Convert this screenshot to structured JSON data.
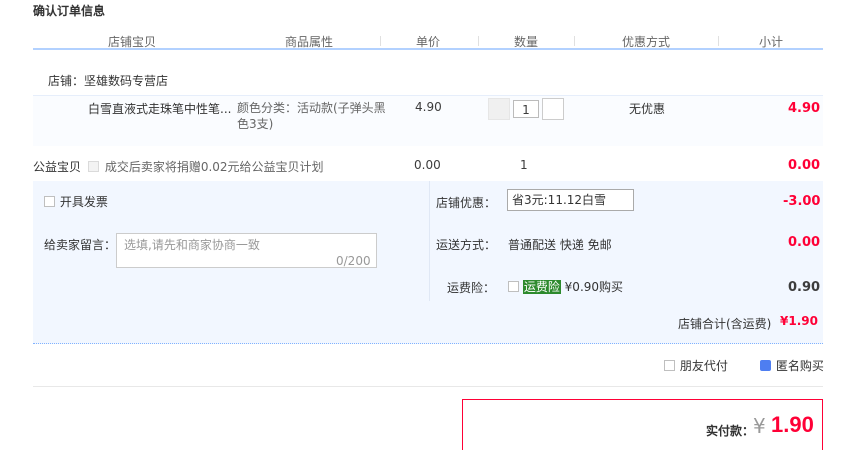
{
  "page_title": "确认订单信息",
  "columns": [
    "店铺宝贝",
    "商品属性",
    "单价",
    "数量",
    "优惠方式",
    "小计"
  ],
  "shop": {
    "label": "店铺：",
    "name": "坚雄数码专营店"
  },
  "item": {
    "name": "白雪直液式走珠笔中性笔...",
    "attr": "颜色分类：活动款(子弹头黑色3支)",
    "price": "4.90",
    "quantity": "1",
    "discount": "无优惠",
    "subtotal": "4.90"
  },
  "charity": {
    "label": "公益宝贝",
    "text": "成交后卖家将捐赠0.02元给公益宝贝计划",
    "price": "0.00",
    "quantity": "1",
    "subtotal": "0.00"
  },
  "invoice": {
    "label": "开具发票",
    "checked": false
  },
  "message": {
    "label": "给卖家留言：",
    "placeholder": "选填,请先和商家协商一致",
    "count": "0/200"
  },
  "shop_coupon": {
    "label": "店铺优惠：",
    "value": "省3元:11.12白雪",
    "amount": "-3.00"
  },
  "shipping": {
    "label": "运送方式：",
    "value": "普通配送 快递 免邮",
    "amount": "0.00"
  },
  "freight_insurance": {
    "label": "运费险：",
    "tag": "运费险",
    "text": "¥0.90购买",
    "amount": "0.90"
  },
  "shop_total": {
    "label": "店铺合计(含运费)",
    "amount": "¥1.90"
  },
  "friend_pay": {
    "label": "朋友代付",
    "checked": false
  },
  "anonymous": {
    "label": "匿名购买",
    "checked": true
  },
  "payment": {
    "label": "实付款：",
    "currency": "¥",
    "amount": "1.90"
  },
  "colors": {
    "accent_red": "#ff0036",
    "header_line": "#b2d1ff",
    "band": "#f2f7ff",
    "checkbox_blue": "#4e7ef1",
    "tag_green": "#2d8a2d"
  }
}
